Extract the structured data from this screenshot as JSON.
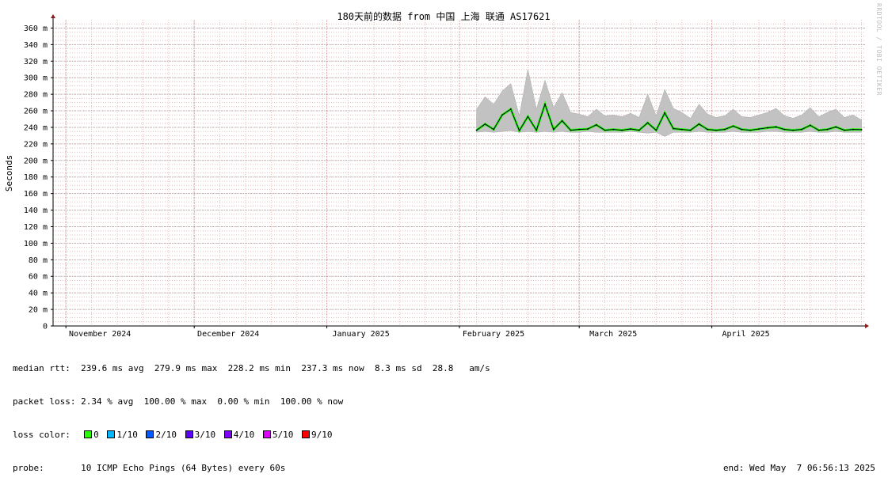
{
  "watermark": "RRDTOOL / TOBI OETIKER",
  "chart_data": {
    "type": "area",
    "title": "180天前的数据 from 中国 上海 联通 AS17621",
    "ylabel": "Seconds",
    "ylim": [
      0,
      0.37
    ],
    "y_ticks": [
      {
        "value": 0,
        "label": "0"
      },
      {
        "value": 0.02,
        "label": "20 m"
      },
      {
        "value": 0.04,
        "label": "40 m"
      },
      {
        "value": 0.06,
        "label": "60 m"
      },
      {
        "value": 0.08,
        "label": "80 m"
      },
      {
        "value": 0.1,
        "label": "100 m"
      },
      {
        "value": 0.12,
        "label": "120 m"
      },
      {
        "value": 0.14,
        "label": "140 m"
      },
      {
        "value": 0.16,
        "label": "160 m"
      },
      {
        "value": 0.18,
        "label": "180 m"
      },
      {
        "value": 0.2,
        "label": "200 m"
      },
      {
        "value": 0.22,
        "label": "220 m"
      },
      {
        "value": 0.24,
        "label": "240 m"
      },
      {
        "value": 0.26,
        "label": "260 m"
      },
      {
        "value": 0.28,
        "label": "280 m"
      },
      {
        "value": 0.3,
        "label": "300 m"
      },
      {
        "value": 0.32,
        "label": "320 m"
      },
      {
        "value": 0.34,
        "label": "340 m"
      },
      {
        "value": 0.36,
        "label": "360 m"
      }
    ],
    "xlim": [
      "2024-10-29",
      "2025-05-07"
    ],
    "x_ticks": [
      {
        "date": "2024-11-01",
        "label": "November 2024"
      },
      {
        "date": "2024-12-01",
        "label": "December 2024"
      },
      {
        "date": "2025-01-01",
        "label": "January 2025"
      },
      {
        "date": "2025-02-01",
        "label": "February 2025"
      },
      {
        "date": "2025-03-01",
        "label": "March 2025"
      },
      {
        "date": "2025-04-01",
        "label": "April 2025"
      }
    ],
    "grid": true,
    "series": [
      {
        "name": "median rtt",
        "x": [
          "2025-02-05",
          "2025-02-07",
          "2025-02-09",
          "2025-02-11",
          "2025-02-13",
          "2025-02-15",
          "2025-02-17",
          "2025-02-19",
          "2025-02-21",
          "2025-02-23",
          "2025-02-25",
          "2025-02-27",
          "2025-03-01",
          "2025-03-03",
          "2025-03-05",
          "2025-03-07",
          "2025-03-09",
          "2025-03-11",
          "2025-03-13",
          "2025-03-15",
          "2025-03-17",
          "2025-03-19",
          "2025-03-21",
          "2025-03-23",
          "2025-03-25",
          "2025-03-27",
          "2025-03-29",
          "2025-03-31",
          "2025-04-02",
          "2025-04-04",
          "2025-04-06",
          "2025-04-08",
          "2025-04-10",
          "2025-04-12",
          "2025-04-14",
          "2025-04-16",
          "2025-04-18",
          "2025-04-20",
          "2025-04-22",
          "2025-04-24",
          "2025-04-26",
          "2025-04-28",
          "2025-04-30",
          "2025-05-02",
          "2025-05-04",
          "2025-05-06"
        ],
        "values": [
          0.2365,
          0.244,
          0.2375,
          0.255,
          0.262,
          0.236,
          0.253,
          0.2365,
          0.268,
          0.2375,
          0.248,
          0.2365,
          0.2375,
          0.238,
          0.243,
          0.2365,
          0.2375,
          0.2365,
          0.238,
          0.2365,
          0.2455,
          0.2365,
          0.2575,
          0.2385,
          0.2375,
          0.2365,
          0.244,
          0.2375,
          0.2365,
          0.2375,
          0.2415,
          0.2375,
          0.2365,
          0.238,
          0.2395,
          0.2405,
          0.2375,
          0.2365,
          0.2375,
          0.2425,
          0.2365,
          0.2375,
          0.2405,
          0.2365,
          0.2375,
          0.2372
        ]
      },
      {
        "name": "rtt spread max",
        "x": [
          "2025-02-05",
          "2025-02-07",
          "2025-02-09",
          "2025-02-11",
          "2025-02-13",
          "2025-02-15",
          "2025-02-17",
          "2025-02-19",
          "2025-02-21",
          "2025-02-23",
          "2025-02-25",
          "2025-02-27",
          "2025-03-01",
          "2025-03-03",
          "2025-03-05",
          "2025-03-07",
          "2025-03-09",
          "2025-03-11",
          "2025-03-13",
          "2025-03-15",
          "2025-03-17",
          "2025-03-19",
          "2025-03-21",
          "2025-03-23",
          "2025-03-25",
          "2025-03-27",
          "2025-03-29",
          "2025-03-31",
          "2025-04-02",
          "2025-04-04",
          "2025-04-06",
          "2025-04-08",
          "2025-04-10",
          "2025-04-12",
          "2025-04-14",
          "2025-04-16",
          "2025-04-18",
          "2025-04-20",
          "2025-04-22",
          "2025-04-24",
          "2025-04-26",
          "2025-04-28",
          "2025-04-30",
          "2025-05-02",
          "2025-05-04",
          "2025-05-06"
        ],
        "values": [
          0.262,
          0.277,
          0.268,
          0.284,
          0.293,
          0.254,
          0.31,
          0.262,
          0.297,
          0.264,
          0.282,
          0.258,
          0.256,
          0.253,
          0.262,
          0.254,
          0.255,
          0.253,
          0.257,
          0.252,
          0.28,
          0.254,
          0.286,
          0.263,
          0.258,
          0.251,
          0.268,
          0.256,
          0.252,
          0.254,
          0.262,
          0.253,
          0.252,
          0.255,
          0.258,
          0.263,
          0.254,
          0.251,
          0.255,
          0.264,
          0.253,
          0.258,
          0.262,
          0.252,
          0.255,
          0.249
        ]
      },
      {
        "name": "rtt spread min",
        "x": [
          "2025-02-05",
          "2025-02-07",
          "2025-02-09",
          "2025-02-11",
          "2025-02-13",
          "2025-02-15",
          "2025-02-17",
          "2025-02-19",
          "2025-02-21",
          "2025-02-23",
          "2025-02-25",
          "2025-02-27",
          "2025-03-01",
          "2025-03-03",
          "2025-03-05",
          "2025-03-07",
          "2025-03-09",
          "2025-03-11",
          "2025-03-13",
          "2025-03-15",
          "2025-03-17",
          "2025-03-19",
          "2025-03-21",
          "2025-03-23",
          "2025-03-25",
          "2025-03-27",
          "2025-03-29",
          "2025-03-31",
          "2025-04-02",
          "2025-04-04",
          "2025-04-06",
          "2025-04-08",
          "2025-04-10",
          "2025-04-12",
          "2025-04-14",
          "2025-04-16",
          "2025-04-18",
          "2025-04-20",
          "2025-04-22",
          "2025-04-24",
          "2025-04-26",
          "2025-04-28",
          "2025-04-30",
          "2025-05-02",
          "2025-05-04",
          "2025-05-06"
        ],
        "values": [
          0.234,
          0.235,
          0.234,
          0.235,
          0.236,
          0.234,
          0.235,
          0.234,
          0.235,
          0.234,
          0.235,
          0.234,
          0.234,
          0.235,
          0.234,
          0.234,
          0.234,
          0.234,
          0.235,
          0.234,
          0.233,
          0.234,
          0.229,
          0.234,
          0.234,
          0.234,
          0.235,
          0.234,
          0.234,
          0.234,
          0.235,
          0.234,
          0.234,
          0.234,
          0.235,
          0.235,
          0.234,
          0.234,
          0.234,
          0.235,
          0.234,
          0.234,
          0.235,
          0.234,
          0.234,
          0.234
        ]
      }
    ],
    "colors": {
      "median_line": "#000000",
      "rtt_spread": "#c2c2c2",
      "grid_minor": "#e7bcbc",
      "grid_major": "#d89a9a",
      "axis": "#000000",
      "arrow": "#8b1a1a",
      "loss_0": "#26ff00",
      "loss_1": "#00b8ff",
      "loss_2": "#0059ff"
    }
  },
  "legend": {
    "median": {
      "label": "median rtt:",
      "avg": "239.6 ms avg",
      "max": "279.9 ms max",
      "min": "228.2 ms min",
      "now": "237.3 ms now",
      "sd": "8.3 ms sd",
      "ams": "28.8   am/s"
    },
    "packet_loss": {
      "label": "packet loss:",
      "avg": "2.34 % avg",
      "max": "100.00 % max",
      "min": "0.00 % min",
      "now": "100.00 % now"
    },
    "loss_color": {
      "label": "loss color:",
      "items": [
        {
          "label": "0",
          "color": "#26ff00"
        },
        {
          "label": "1/10",
          "color": "#00b8ff"
        },
        {
          "label": "2/10",
          "color": "#0059ff"
        },
        {
          "label": "3/10",
          "color": "#5e00ff"
        },
        {
          "label": "4/10",
          "color": "#7e00ff"
        },
        {
          "label": "5/10",
          "color": "#dd00ff"
        },
        {
          "label": "9/10",
          "color": "#ff0000"
        }
      ]
    },
    "probe": {
      "label": "probe:",
      "text": "10 ICMP Echo Pings (64 Bytes) every 60s"
    },
    "end": "end: Wed May  7 06:56:13 2025"
  }
}
